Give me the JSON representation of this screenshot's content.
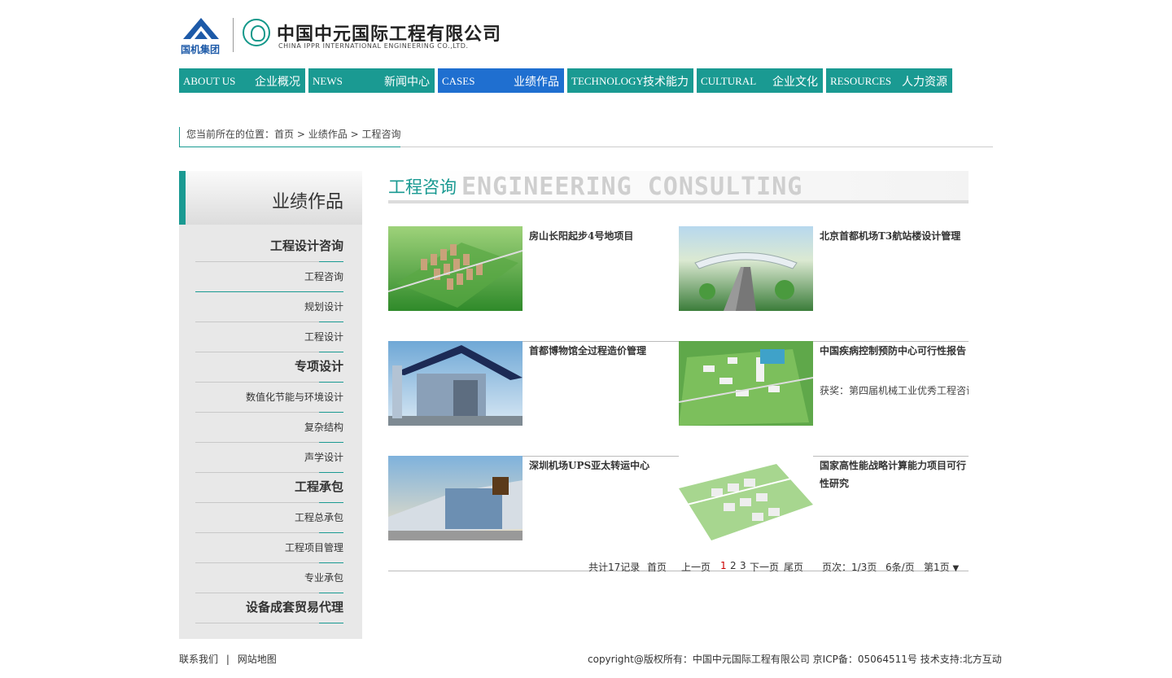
{
  "header": {
    "group_name": "国机集团",
    "company_cn": "中国中元国际工程有限公司",
    "company_en": "CHINA IPPR INTERNATIONAL ENGINEERING CO.,LTD."
  },
  "nav": [
    {
      "en": "ABOUT US",
      "cn": "企业概况"
    },
    {
      "en": "NEWS",
      "cn": "新闻中心"
    },
    {
      "en": "CASES",
      "cn": "业绩作品",
      "active": true
    },
    {
      "en": "TECHNOLOGY",
      "cn": "技术能力"
    },
    {
      "en": "CULTURAL",
      "cn": "企业文化"
    },
    {
      "en": "RESOURCES",
      "cn": "人力资源"
    }
  ],
  "breadcrumb": {
    "prefix": "您当前所在的位置：",
    "home": "首页",
    "sep": ">",
    "level1": "业绩作品",
    "level2": "工程咨询"
  },
  "sidebar": {
    "title": "业绩作品",
    "items": [
      {
        "label": "工程设计咨询",
        "type": "category"
      },
      {
        "label": "工程咨询",
        "type": "item",
        "active": true
      },
      {
        "label": "规划设计",
        "type": "item"
      },
      {
        "label": "工程设计",
        "type": "item"
      },
      {
        "label": "专项设计",
        "type": "category"
      },
      {
        "label": "数值化节能与环境设计",
        "type": "item"
      },
      {
        "label": "复杂结构",
        "type": "item"
      },
      {
        "label": "声学设计",
        "type": "item"
      },
      {
        "label": "工程承包",
        "type": "category"
      },
      {
        "label": "工程总承包",
        "type": "item"
      },
      {
        "label": "工程项目管理",
        "type": "item"
      },
      {
        "label": "专业承包",
        "type": "item"
      },
      {
        "label": "设备成套贸易代理",
        "type": "category"
      }
    ]
  },
  "content": {
    "title_cn": "工程咨询",
    "title_en": "ENGINEERING CONSULTING"
  },
  "projects": [
    {
      "title": "房山长阳起步4号地项目",
      "award": "",
      "thumb": "residential-aerial"
    },
    {
      "title": "北京首都机场T3航站楼设计管理",
      "award": "",
      "thumb": "airport-terminal"
    },
    {
      "title": "首都博物馆全过程造价管理",
      "award": "",
      "thumb": "museum-building"
    },
    {
      "title": "中国疾病控制预防中心可行性报告",
      "award": "获奖：第四届机械工业优秀工程咨询",
      "thumb": "campus-aerial"
    },
    {
      "title": "深圳机场UPS亚太转运中心",
      "award": "",
      "thumb": "ups-hub"
    },
    {
      "title": "国家高性能战略计算能力项目可行性研究",
      "award": "",
      "thumb": "computing-campus"
    }
  ],
  "pager": {
    "total": "共计17记录",
    "first": "首页",
    "prev": "上一页",
    "pages": [
      "1",
      "2",
      "3"
    ],
    "current": "1",
    "next": "下一页",
    "last": "尾页",
    "page_info": "页次：1/3页",
    "per_page": "6条/页",
    "select": "第1页"
  },
  "footer": {
    "contact": "联系我们",
    "divider": "|",
    "sitemap": "网站地图",
    "copyright": "copyright@版权所有：中国中元国际工程有限公司 京ICP备：05064511号  技术支持:北方互动"
  },
  "colors": {
    "teal": "#1a9a92",
    "active_blue": "#1f6fd0",
    "sinomach_blue": "#1d5aa8"
  }
}
